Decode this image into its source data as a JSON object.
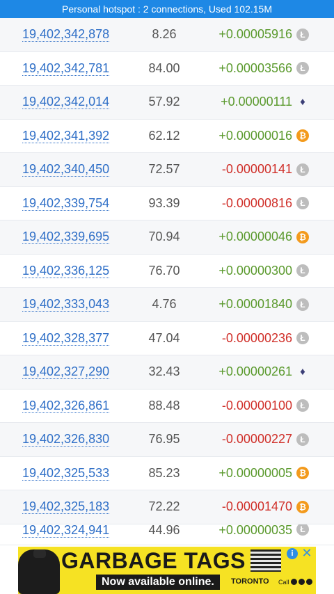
{
  "status_bar": {
    "text": "Personal hotspot : 2 connections, Used 102.15M"
  },
  "bets": [
    {
      "id": "19,402,342,878",
      "roll": "8.26",
      "profit": "+0.00005916",
      "sign": "pos",
      "coin": "ltc"
    },
    {
      "id": "19,402,342,781",
      "roll": "84.00",
      "profit": "+0.00003566",
      "sign": "pos",
      "coin": "ltc"
    },
    {
      "id": "19,402,342,014",
      "roll": "57.92",
      "profit": "+0.00000111",
      "sign": "pos",
      "coin": "eth"
    },
    {
      "id": "19,402,341,392",
      "roll": "62.12",
      "profit": "+0.00000016",
      "sign": "pos",
      "coin": "btc"
    },
    {
      "id": "19,402,340,450",
      "roll": "72.57",
      "profit": "-0.00000141",
      "sign": "neg",
      "coin": "ltc"
    },
    {
      "id": "19,402,339,754",
      "roll": "93.39",
      "profit": "-0.00000816",
      "sign": "neg",
      "coin": "ltc"
    },
    {
      "id": "19,402,339,695",
      "roll": "70.94",
      "profit": "+0.00000046",
      "sign": "pos",
      "coin": "btc"
    },
    {
      "id": "19,402,336,125",
      "roll": "76.70",
      "profit": "+0.00000300",
      "sign": "pos",
      "coin": "ltc"
    },
    {
      "id": "19,402,333,043",
      "roll": "4.76",
      "profit": "+0.00001840",
      "sign": "pos",
      "coin": "ltc"
    },
    {
      "id": "19,402,328,377",
      "roll": "47.04",
      "profit": "-0.00000236",
      "sign": "neg",
      "coin": "ltc"
    },
    {
      "id": "19,402,327,290",
      "roll": "32.43",
      "profit": "+0.00000261",
      "sign": "pos",
      "coin": "eth"
    },
    {
      "id": "19,402,326,861",
      "roll": "88.48",
      "profit": "-0.00000100",
      "sign": "neg",
      "coin": "ltc"
    },
    {
      "id": "19,402,326,830",
      "roll": "76.95",
      "profit": "-0.00000227",
      "sign": "neg",
      "coin": "ltc"
    },
    {
      "id": "19,402,325,533",
      "roll": "85.23",
      "profit": "+0.00000005",
      "sign": "pos",
      "coin": "btc"
    },
    {
      "id": "19,402,325,183",
      "roll": "72.22",
      "profit": "-0.00001470",
      "sign": "neg",
      "coin": "btc"
    },
    {
      "id": "19,402,324,941",
      "roll": "44.96",
      "profit": "+0.00000035",
      "sign": "pos",
      "coin": "ltc"
    }
  ],
  "coin_glyphs": {
    "ltc": "Ł",
    "btc": "₿",
    "eth": "♦"
  },
  "coin_icon_names": {
    "ltc": "litecoin-icon",
    "btc": "bitcoin-icon",
    "eth": "ethereum-icon"
  },
  "ad": {
    "title": "GARBAGE TAGS",
    "subtitle": "Now available online.",
    "brand": "TORONTO",
    "cta": "Call",
    "info_icon": "i",
    "close_icon": "✕"
  }
}
